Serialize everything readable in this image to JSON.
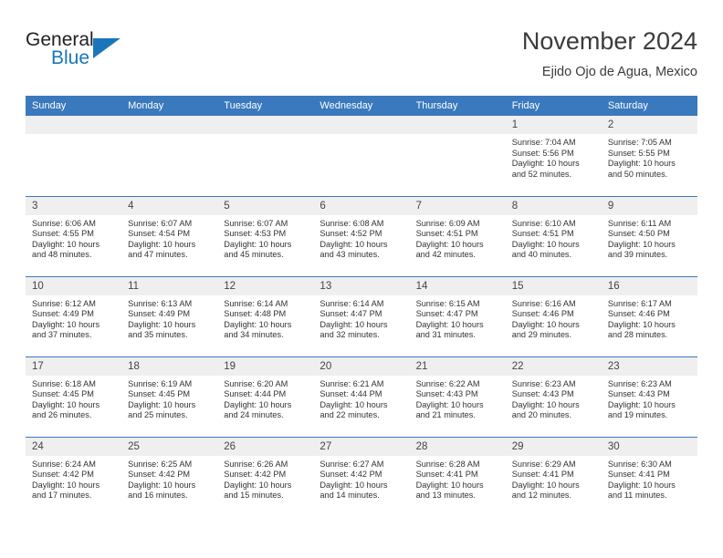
{
  "brand": {
    "word_general": "General",
    "word_blue": "Blue",
    "triangle_color": "#1b75bb"
  },
  "header": {
    "title": "November 2024",
    "subtitle": "Ejido Ojo de Agua, Mexico"
  },
  "theme": {
    "header_row_bg": "#3a79bd",
    "day_number_bg": "#efefef",
    "grid_line": "#3a79bd",
    "text": "#333333"
  },
  "weekdays": [
    "Sunday",
    "Monday",
    "Tuesday",
    "Wednesday",
    "Thursday",
    "Friday",
    "Saturday"
  ],
  "weeks": [
    [
      {
        "day": "",
        "empty": true
      },
      {
        "day": "",
        "empty": true
      },
      {
        "day": "",
        "empty": true
      },
      {
        "day": "",
        "empty": true
      },
      {
        "day": "",
        "empty": true
      },
      {
        "day": "1",
        "sunrise": "Sunrise: 7:04 AM",
        "sunset": "Sunset: 5:56 PM",
        "daylight": "Daylight: 10 hours and 52 minutes."
      },
      {
        "day": "2",
        "sunrise": "Sunrise: 7:05 AM",
        "sunset": "Sunset: 5:55 PM",
        "daylight": "Daylight: 10 hours and 50 minutes."
      }
    ],
    [
      {
        "day": "3",
        "sunrise": "Sunrise: 6:06 AM",
        "sunset": "Sunset: 4:55 PM",
        "daylight": "Daylight: 10 hours and 48 minutes."
      },
      {
        "day": "4",
        "sunrise": "Sunrise: 6:07 AM",
        "sunset": "Sunset: 4:54 PM",
        "daylight": "Daylight: 10 hours and 47 minutes."
      },
      {
        "day": "5",
        "sunrise": "Sunrise: 6:07 AM",
        "sunset": "Sunset: 4:53 PM",
        "daylight": "Daylight: 10 hours and 45 minutes."
      },
      {
        "day": "6",
        "sunrise": "Sunrise: 6:08 AM",
        "sunset": "Sunset: 4:52 PM",
        "daylight": "Daylight: 10 hours and 43 minutes."
      },
      {
        "day": "7",
        "sunrise": "Sunrise: 6:09 AM",
        "sunset": "Sunset: 4:51 PM",
        "daylight": "Daylight: 10 hours and 42 minutes."
      },
      {
        "day": "8",
        "sunrise": "Sunrise: 6:10 AM",
        "sunset": "Sunset: 4:51 PM",
        "daylight": "Daylight: 10 hours and 40 minutes."
      },
      {
        "day": "9",
        "sunrise": "Sunrise: 6:11 AM",
        "sunset": "Sunset: 4:50 PM",
        "daylight": "Daylight: 10 hours and 39 minutes."
      }
    ],
    [
      {
        "day": "10",
        "sunrise": "Sunrise: 6:12 AM",
        "sunset": "Sunset: 4:49 PM",
        "daylight": "Daylight: 10 hours and 37 minutes."
      },
      {
        "day": "11",
        "sunrise": "Sunrise: 6:13 AM",
        "sunset": "Sunset: 4:49 PM",
        "daylight": "Daylight: 10 hours and 35 minutes."
      },
      {
        "day": "12",
        "sunrise": "Sunrise: 6:14 AM",
        "sunset": "Sunset: 4:48 PM",
        "daylight": "Daylight: 10 hours and 34 minutes."
      },
      {
        "day": "13",
        "sunrise": "Sunrise: 6:14 AM",
        "sunset": "Sunset: 4:47 PM",
        "daylight": "Daylight: 10 hours and 32 minutes."
      },
      {
        "day": "14",
        "sunrise": "Sunrise: 6:15 AM",
        "sunset": "Sunset: 4:47 PM",
        "daylight": "Daylight: 10 hours and 31 minutes."
      },
      {
        "day": "15",
        "sunrise": "Sunrise: 6:16 AM",
        "sunset": "Sunset: 4:46 PM",
        "daylight": "Daylight: 10 hours and 29 minutes."
      },
      {
        "day": "16",
        "sunrise": "Sunrise: 6:17 AM",
        "sunset": "Sunset: 4:46 PM",
        "daylight": "Daylight: 10 hours and 28 minutes."
      }
    ],
    [
      {
        "day": "17",
        "sunrise": "Sunrise: 6:18 AM",
        "sunset": "Sunset: 4:45 PM",
        "daylight": "Daylight: 10 hours and 26 minutes."
      },
      {
        "day": "18",
        "sunrise": "Sunrise: 6:19 AM",
        "sunset": "Sunset: 4:45 PM",
        "daylight": "Daylight: 10 hours and 25 minutes."
      },
      {
        "day": "19",
        "sunrise": "Sunrise: 6:20 AM",
        "sunset": "Sunset: 4:44 PM",
        "daylight": "Daylight: 10 hours and 24 minutes."
      },
      {
        "day": "20",
        "sunrise": "Sunrise: 6:21 AM",
        "sunset": "Sunset: 4:44 PM",
        "daylight": "Daylight: 10 hours and 22 minutes."
      },
      {
        "day": "21",
        "sunrise": "Sunrise: 6:22 AM",
        "sunset": "Sunset: 4:43 PM",
        "daylight": "Daylight: 10 hours and 21 minutes."
      },
      {
        "day": "22",
        "sunrise": "Sunrise: 6:23 AM",
        "sunset": "Sunset: 4:43 PM",
        "daylight": "Daylight: 10 hours and 20 minutes."
      },
      {
        "day": "23",
        "sunrise": "Sunrise: 6:23 AM",
        "sunset": "Sunset: 4:43 PM",
        "daylight": "Daylight: 10 hours and 19 minutes."
      }
    ],
    [
      {
        "day": "24",
        "sunrise": "Sunrise: 6:24 AM",
        "sunset": "Sunset: 4:42 PM",
        "daylight": "Daylight: 10 hours and 17 minutes."
      },
      {
        "day": "25",
        "sunrise": "Sunrise: 6:25 AM",
        "sunset": "Sunset: 4:42 PM",
        "daylight": "Daylight: 10 hours and 16 minutes."
      },
      {
        "day": "26",
        "sunrise": "Sunrise: 6:26 AM",
        "sunset": "Sunset: 4:42 PM",
        "daylight": "Daylight: 10 hours and 15 minutes."
      },
      {
        "day": "27",
        "sunrise": "Sunrise: 6:27 AM",
        "sunset": "Sunset: 4:42 PM",
        "daylight": "Daylight: 10 hours and 14 minutes."
      },
      {
        "day": "28",
        "sunrise": "Sunrise: 6:28 AM",
        "sunset": "Sunset: 4:41 PM",
        "daylight": "Daylight: 10 hours and 13 minutes."
      },
      {
        "day": "29",
        "sunrise": "Sunrise: 6:29 AM",
        "sunset": "Sunset: 4:41 PM",
        "daylight": "Daylight: 10 hours and 12 minutes."
      },
      {
        "day": "30",
        "sunrise": "Sunrise: 6:30 AM",
        "sunset": "Sunset: 4:41 PM",
        "daylight": "Daylight: 10 hours and 11 minutes."
      }
    ]
  ]
}
